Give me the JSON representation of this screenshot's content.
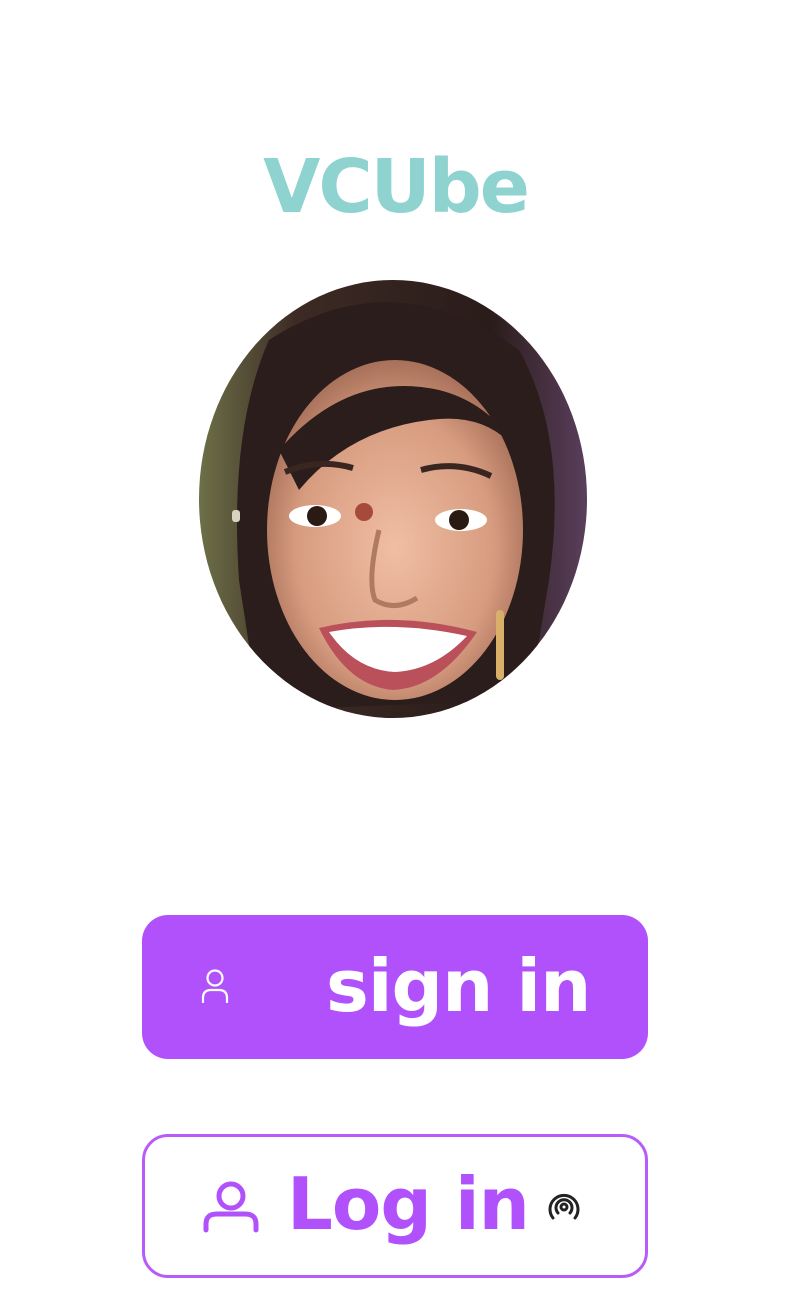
{
  "app": {
    "title": "VCUbe",
    "title_color": "#8ed3d0",
    "accent_color": "#b151fb"
  },
  "profile": {
    "avatar": "user-photo"
  },
  "buttons": {
    "signin": {
      "label": "sign in",
      "icon": "user-icon",
      "style": "filled"
    },
    "login": {
      "label": "Log in",
      "icon_left": "user-icon",
      "icon_right": "broadcast-icon",
      "style": "outlined"
    }
  }
}
